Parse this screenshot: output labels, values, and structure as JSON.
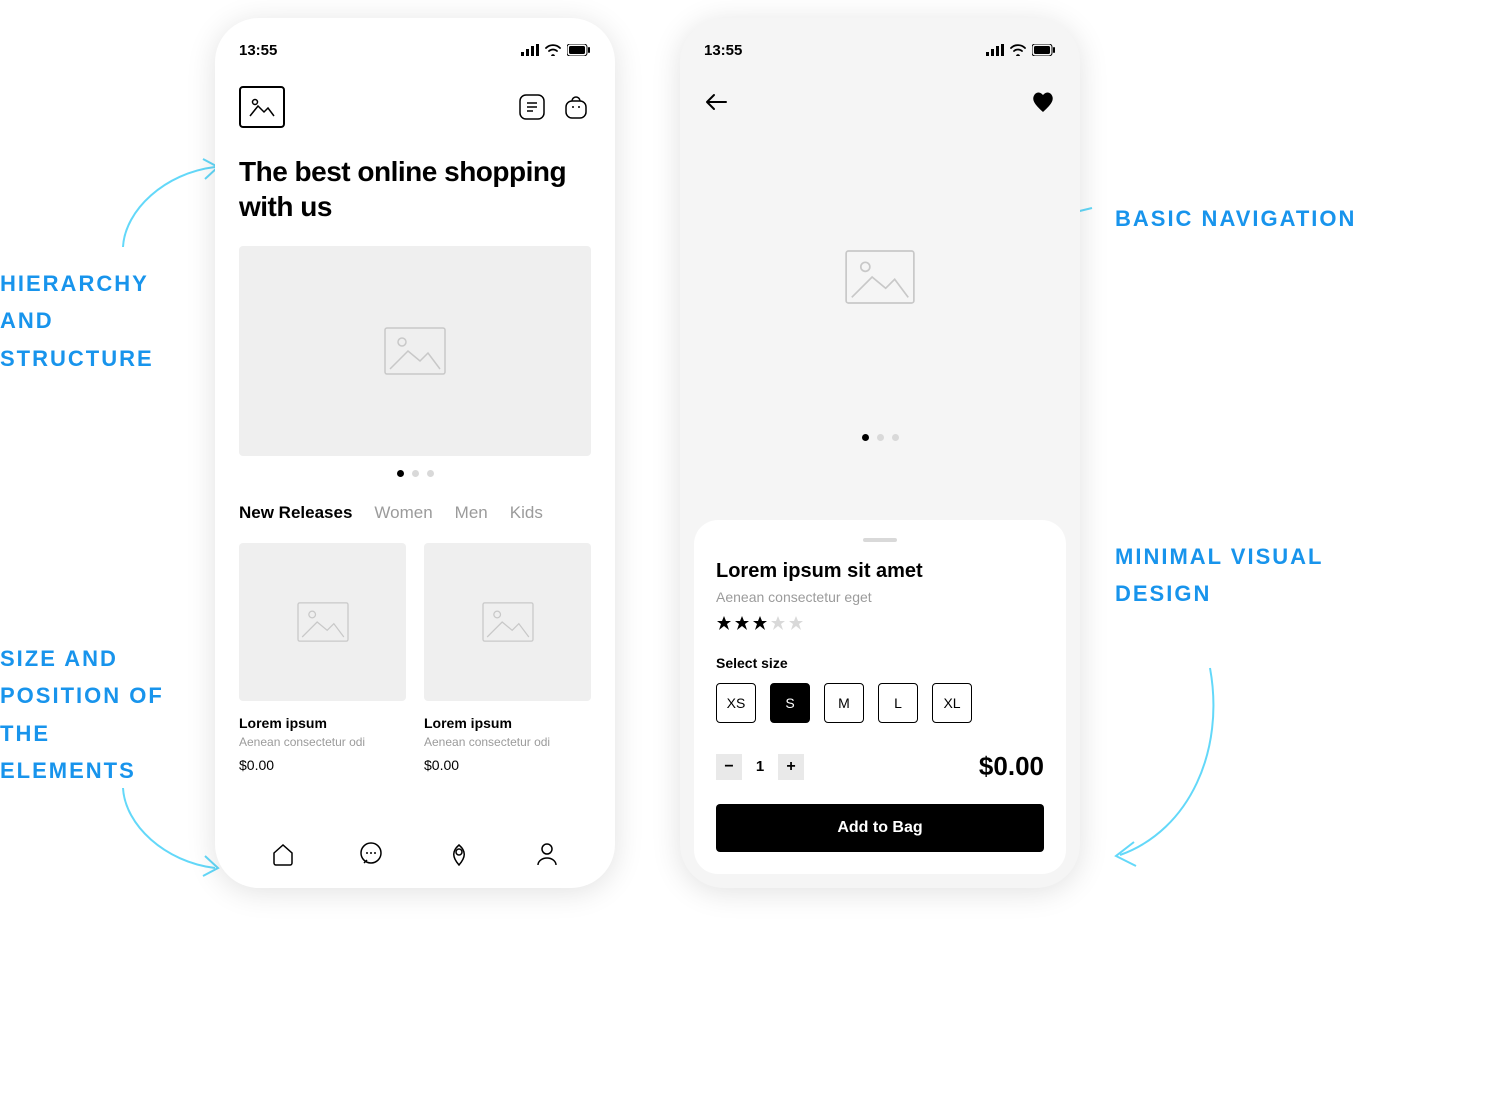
{
  "annotations": {
    "topLeft": "HIERARCHY AND STRUCTURE",
    "bottomLeft": "SIZE AND POSITION OF THE ELEMENTS",
    "topRight": "BASIC NAVIGATION",
    "bottomRight": "MINIMAL VISUAL DESIGN"
  },
  "shared": {
    "time": "13:55"
  },
  "home": {
    "headline": "The best online shopping with us",
    "tabs": [
      "New Releases",
      "Women",
      "Men",
      "Kids"
    ],
    "tabActiveIndex": 0,
    "dotsCount": 3,
    "dotActiveIndex": 0,
    "products": [
      {
        "title": "Lorem ipsum",
        "subtitle": "Aenean consectetur odi",
        "price": "$0.00"
      },
      {
        "title": "Lorem ipsum",
        "subtitle": "Aenean consectetur odi",
        "price": "$0.00"
      }
    ],
    "icons": {
      "logo": "image-icon",
      "headerRight": [
        "list-icon",
        "bag-icon"
      ],
      "navbar": [
        "home-icon",
        "chat-icon",
        "pin-icon",
        "user-icon"
      ]
    }
  },
  "product": {
    "title": "Lorem ipsum sit amet",
    "subtitle": "Aenean consectetur eget",
    "rating": 3,
    "ratingMax": 5,
    "sizeLabel": "Select size",
    "sizes": [
      "XS",
      "S",
      "M",
      "L",
      "XL"
    ],
    "sizeActiveIndex": 1,
    "quantity": 1,
    "price": "$0.00",
    "addToBag": "Add to Bag",
    "dotsCount": 3,
    "dotActiveIndex": 0,
    "icons": {
      "back": "arrow-left-icon",
      "favorite": "heart-icon"
    }
  }
}
